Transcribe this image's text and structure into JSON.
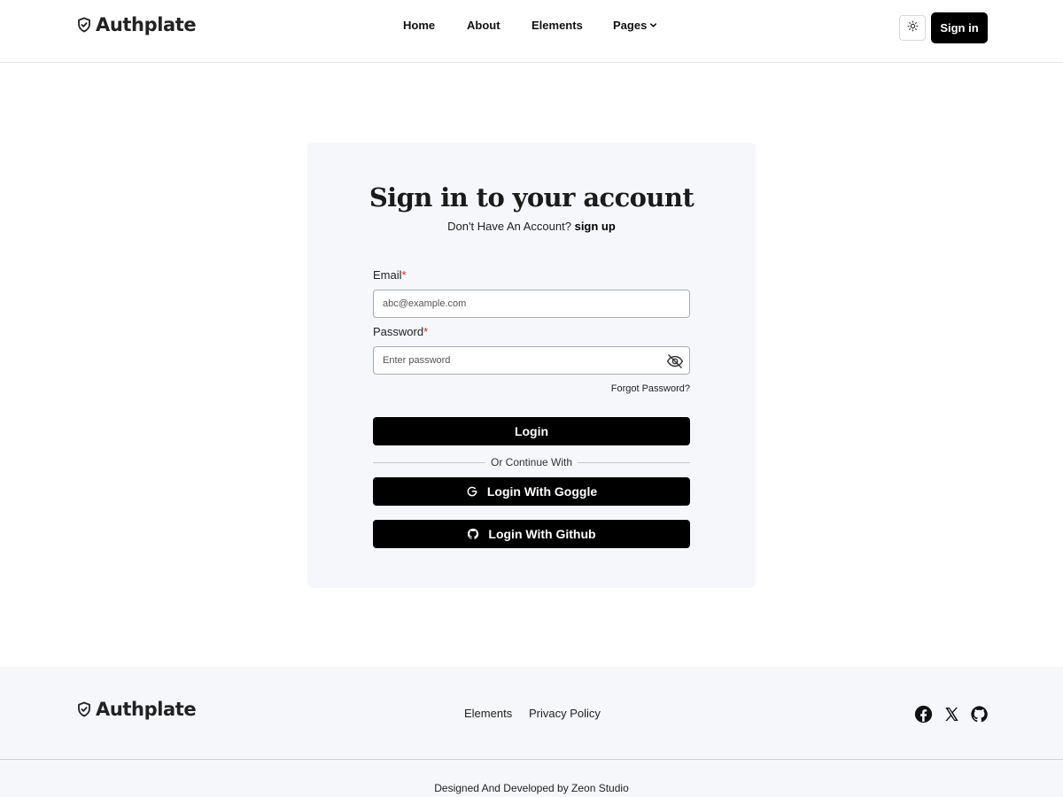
{
  "brand": {
    "name": "Authplate",
    "icon": "shield-check-icon"
  },
  "nav": {
    "items": [
      {
        "label": "Home"
      },
      {
        "label": "About"
      },
      {
        "label": "Elements"
      },
      {
        "label": "Pages",
        "icon": "chevron-down-icon"
      }
    ],
    "theme_toggle_icon": "sun-icon",
    "signin_label": "Sign in"
  },
  "auth": {
    "title": "Sign in to your account",
    "subtitle_text": "Don't Have An Account?",
    "subtitle_link": "sign up",
    "email": {
      "label": "Email",
      "required_mark": "*",
      "placeholder": "abc@example.com"
    },
    "password": {
      "label": "Password",
      "required_mark": "*",
      "placeholder": "Enter password",
      "toggle_icon": "eye-off-icon"
    },
    "forgot_label": "Forgot Password?",
    "login_label": "Login",
    "divider_text": "Or Continue With",
    "google_label": "Login With Goggle",
    "github_label": "Login With Github"
  },
  "footer": {
    "links": [
      {
        "label": "Elements"
      },
      {
        "label": "Privacy Policy"
      }
    ],
    "social": [
      "facebook-icon",
      "x-icon",
      "github-icon"
    ],
    "copyright": "Designed And Developed by Zeon Studio"
  },
  "colors": {
    "primary": "#000000",
    "card_bg": "#f5f7fa",
    "required": "#e02424"
  }
}
